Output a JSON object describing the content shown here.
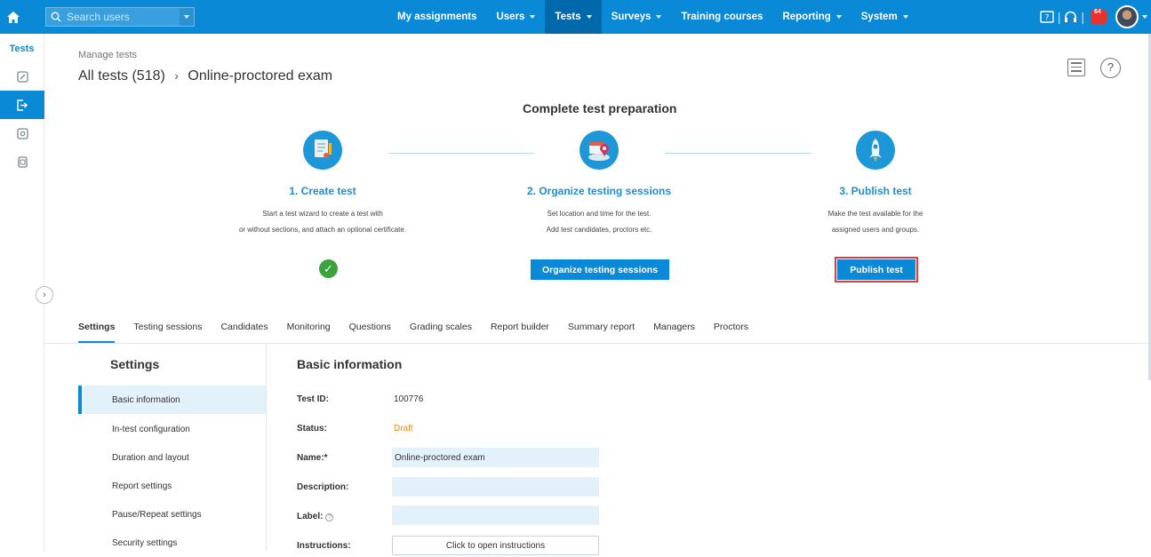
{
  "topbar": {
    "search_placeholder": "Search users",
    "nav": [
      {
        "label": "My assignments",
        "dropdown": false,
        "active": false
      },
      {
        "label": "Users",
        "dropdown": true,
        "active": false
      },
      {
        "label": "Tests",
        "dropdown": true,
        "active": true
      },
      {
        "label": "Surveys",
        "dropdown": true,
        "active": false
      },
      {
        "label": "Training courses",
        "dropdown": false,
        "active": false
      },
      {
        "label": "Reporting",
        "dropdown": true,
        "active": false
      },
      {
        "label": "System",
        "dropdown": true,
        "active": false
      }
    ],
    "notification_count": "64",
    "icons": [
      "home-icon",
      "search-icon",
      "book-icon",
      "headset-icon",
      "notification-icon",
      "avatar"
    ]
  },
  "leftbar": {
    "title": "Tests",
    "items": [
      "edit-icon",
      "exit-icon",
      "settings-icon",
      "document-icon"
    ]
  },
  "header": {
    "small": "Manage tests",
    "crumb": "All tests (518)",
    "crumb_sep": "›",
    "current": "Online-proctored exam"
  },
  "prep": {
    "title": "Complete test preparation",
    "steps": [
      {
        "title": "1. Create test",
        "desc1": "Start a test wizard to create a test with",
        "desc2": "or without sections, and attach an optional certificate."
      },
      {
        "title": "2. Organize testing sessions",
        "desc1": "Set location and time for the test.",
        "desc2": "Add test candidates, proctors etc.",
        "button": "Organize testing sessions"
      },
      {
        "title": "3. Publish test",
        "desc1": "Make the test available for the",
        "desc2": "assigned users and groups.",
        "button": "Publish test"
      }
    ],
    "check": "✓"
  },
  "tabs": [
    "Settings",
    "Testing sessions",
    "Candidates",
    "Monitoring",
    "Questions",
    "Grading scales",
    "Report builder",
    "Summary report",
    "Managers",
    "Proctors"
  ],
  "settings": {
    "title": "Settings",
    "items": [
      "Basic information",
      "In-test configuration",
      "Duration and layout",
      "Report settings",
      "Pause/Repeat settings",
      "Security settings"
    ]
  },
  "basic": {
    "title": "Basic information",
    "test_id_label": "Test ID:",
    "test_id": "100776",
    "status_label": "Status:",
    "status": "Draft",
    "status_color": "#f08a1c",
    "name_label": "Name:*",
    "name": "Online-proctored exam",
    "description_label": "Description:",
    "description": "",
    "label_label": "Label:",
    "label": "",
    "instructions_label": "Instructions:",
    "instructions_button": "Click to open instructions"
  },
  "colors": {
    "primary": "#0a8ad6",
    "active_nav": "#0069ab",
    "highlight": "#e33b3b",
    "check": "#3aa33b"
  }
}
